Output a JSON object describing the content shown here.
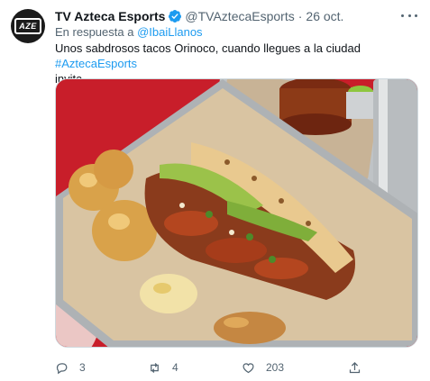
{
  "tweet": {
    "author_name": "TV Azteca Esports",
    "author_handle": "@TVAztecaEsports",
    "separator": "·",
    "date": "26 oct.",
    "avatar_text": "AZE",
    "reply_prefix": "En respuesta a",
    "reply_to": "@IbaiLlanos",
    "text_main": "Unos sabdrosos tacos Orinoco, cuando llegues a la ciudad",
    "hashtag": "#AztecaEsports",
    "text_end": "invita.",
    "media_icon": "food-photo-tacos",
    "stats": {
      "replies": "3",
      "retweets": "4",
      "likes": "203"
    },
    "icons": {
      "verified": "verified-badge-icon",
      "more": "more-icon",
      "reply": "reply-icon",
      "retweet": "retweet-icon",
      "like": "heart-icon",
      "share": "share-icon"
    },
    "colors": {
      "accent": "#1d9bf0",
      "secondary_text": "#536471",
      "primary_text": "#0f1419",
      "tray_red": "#c81e2a"
    }
  }
}
